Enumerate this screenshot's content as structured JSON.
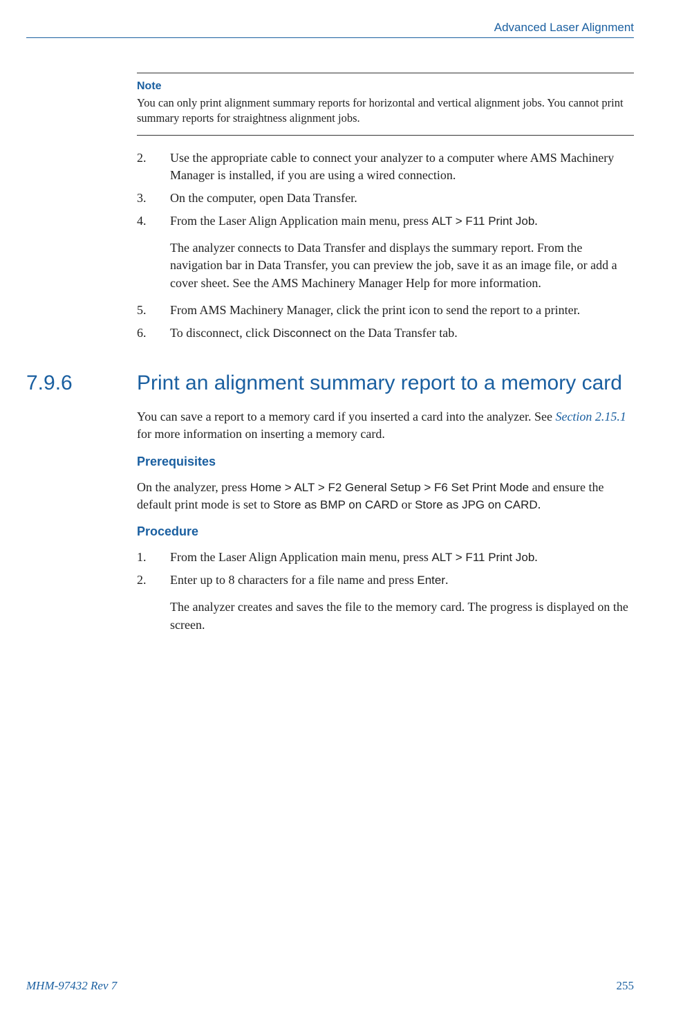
{
  "header": {
    "title": "Advanced Laser Alignment"
  },
  "note": {
    "label": "Note",
    "text": "You can only print alignment summary reports for horizontal and vertical alignment jobs. You cannot print summary reports for straightness alignment jobs."
  },
  "steps_a": {
    "items": [
      {
        "num": "2.",
        "text": "Use the appropriate cable to connect your analyzer to a computer where AMS Machinery Manager is installed, if you are using a wired connection."
      },
      {
        "num": "3.",
        "text": "On the computer, open Data Transfer."
      },
      {
        "num": "4.",
        "text_pre": "From the Laser Align Application main menu, press ",
        "ui": "ALT > F11 Print Job",
        "text_post": ".",
        "result": "The analyzer connects to Data Transfer and displays the summary report. From the navigation bar in Data Transfer, you can preview the job, save it as an image file, or add a cover sheet. See the AMS Machinery Manager Help for more information."
      },
      {
        "num": "5.",
        "text": "From AMS Machinery Manager, click the print icon to send the report to a printer."
      },
      {
        "num": "6.",
        "text_pre": "To disconnect, click ",
        "ui": "Disconnect",
        "text_post": " on the Data Transfer tab."
      }
    ]
  },
  "section": {
    "num": "7.9.6",
    "title": "Print an alignment summary report to a memory card"
  },
  "intro": {
    "pre": "You can save a report to a memory card if you inserted a card into the analyzer. See ",
    "link": "Section 2.15.1",
    "post": " for more information on inserting a memory card."
  },
  "prereq": {
    "heading": "Prerequisites",
    "pre": "On the analyzer, press ",
    "ui1": "Home > ALT > F2 General Setup > F6 Set Print Mode",
    "mid": " and ensure the default print mode is set to ",
    "ui2": "Store as BMP on CARD",
    "or": " or ",
    "ui3": "Store as JPG on CARD",
    "post": "."
  },
  "procedure": {
    "heading": "Procedure",
    "items": [
      {
        "num": "1.",
        "text_pre": "From the Laser Align Application main menu, press ",
        "ui": "ALT > F11 Print Job",
        "text_post": "."
      },
      {
        "num": "2.",
        "text_pre": "Enter up to 8 characters for a file name and press ",
        "ui": "Enter",
        "text_post": ".",
        "result": "The analyzer creates and saves the file to the memory card. The progress is displayed on the screen."
      }
    ]
  },
  "footer": {
    "doc": "MHM-97432 Rev 7",
    "page": "255"
  }
}
